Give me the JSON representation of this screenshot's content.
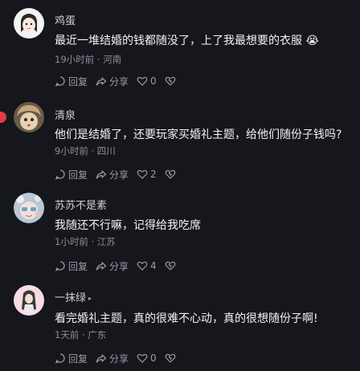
{
  "comments": [
    {
      "name": "鸡蛋",
      "text": "最近一堆结婚的钱都随没了，上了我最想要的衣服 😭",
      "meta": "19小时前 · 河南",
      "reply": "回复",
      "share": "分享",
      "likes": "0"
    },
    {
      "name": "清泉",
      "text": "他们是结婚了，还要玩家买婚礼主题，给他们随份子钱吗?",
      "meta": "9小时前 · 四川",
      "reply": "回复",
      "share": "分享",
      "likes": "2"
    },
    {
      "name": "苏苏不是素",
      "text": "我随还不行嘛，记得给我吃席",
      "meta": "1小时前 · 江苏",
      "reply": "回复",
      "share": "分享",
      "likes": "4"
    },
    {
      "name": "一抹绿",
      "text": "看完婚礼主题，真的很难不心动，真的很想随份子啊!",
      "meta": "1天前 · 广东",
      "reply": "回复",
      "share": "分享",
      "likes": "0"
    }
  ],
  "colors": {
    "background": "#16161d",
    "accent_red": "#e23a4a"
  },
  "icons": [
    "reply-icon",
    "share-icon",
    "like-icon",
    "dislike-icon",
    "author-arrow-icon"
  ]
}
